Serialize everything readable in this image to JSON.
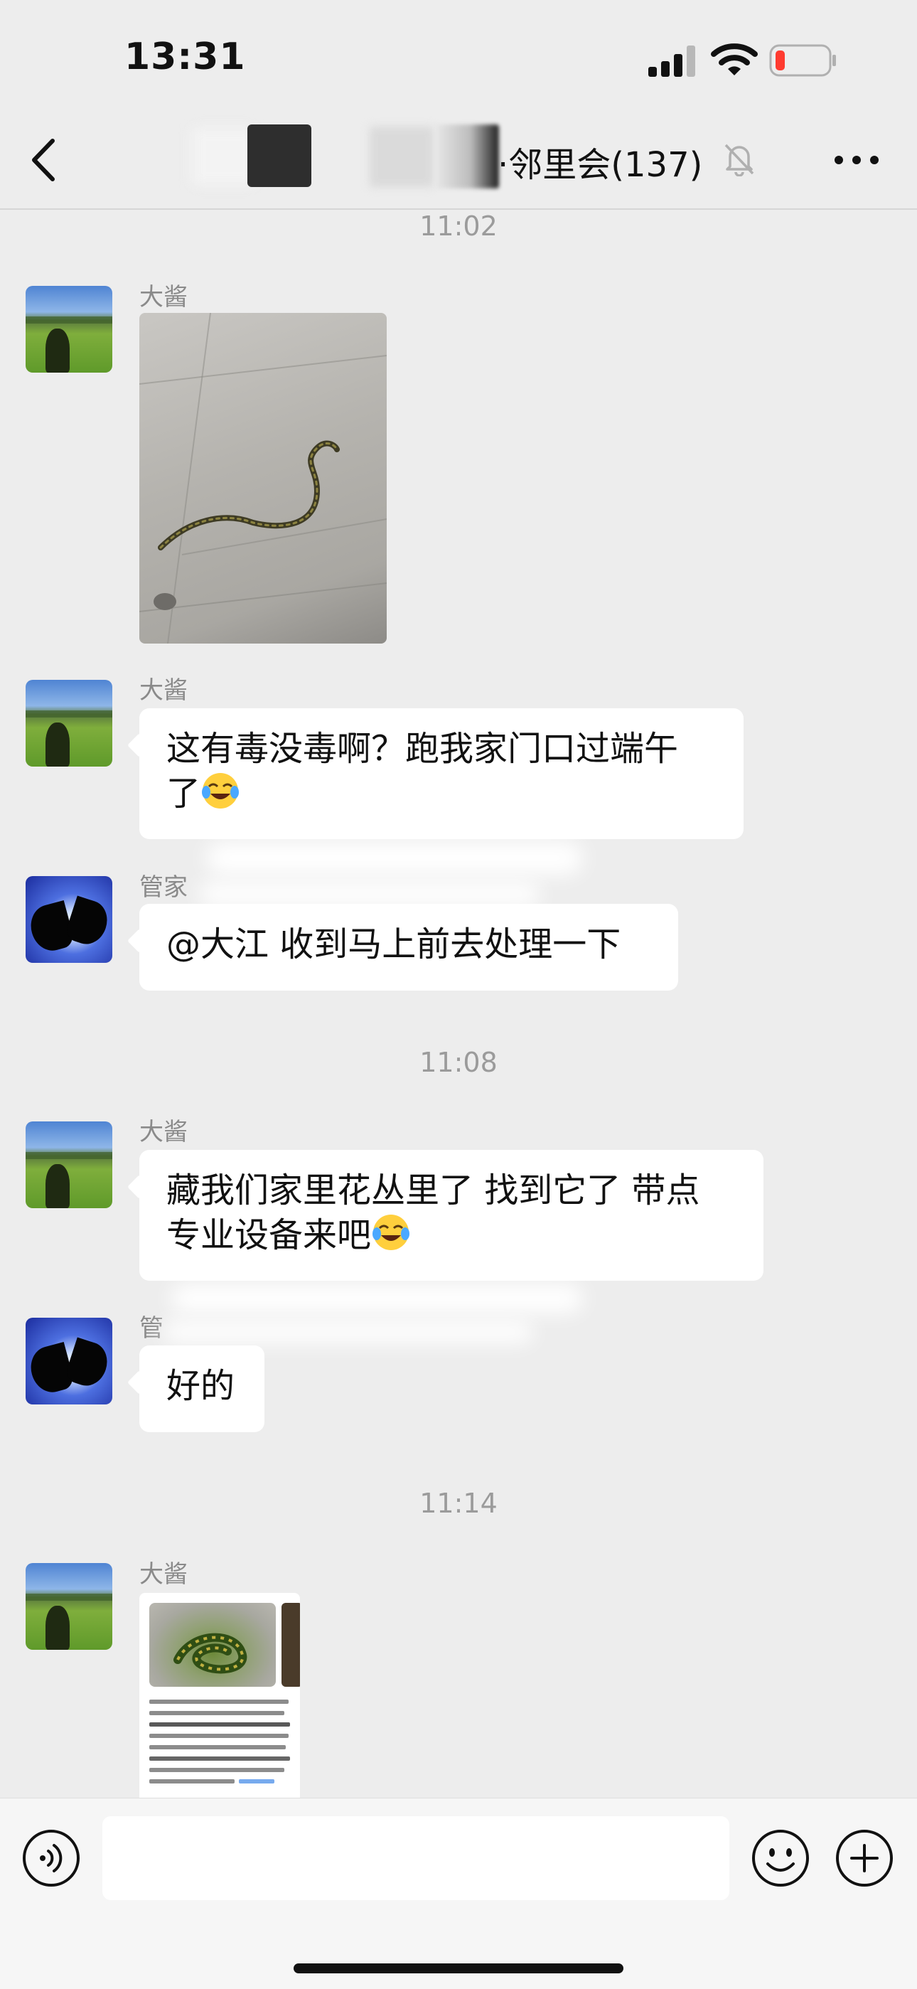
{
  "status_bar": {
    "time": "13:31",
    "icons": [
      "signal-icon",
      "wifi-icon",
      "battery-low-icon"
    ]
  },
  "nav": {
    "back_icon": "chevron-left-icon",
    "title": "·邻里会(137)",
    "mute_icon": "bell-slash-icon",
    "more_icon": "ellipsis-icon"
  },
  "messages": {
    "ts1": "11:02",
    "m1_sender": "大酱",
    "m2_sender": "大酱",
    "m2_line1": "这有毒没毒啊？跑我家门口过端午",
    "m2_line2": "了",
    "m3_sender": "管家",
    "m3_text": "@大江 收到马上前去处理一下",
    "ts2": "11:08",
    "m4_sender": "大酱",
    "m4_line1": "藏我们家里花丛里了 找到它了 带点",
    "m4_line2": "专业设备来吧",
    "m5_sender": "管",
    "m5_text": "好的",
    "ts3": "11:14",
    "m6_sender": "大酱"
  },
  "input_bar": {
    "voice_icon": "voice-icon",
    "emoji_icon": "smiley-icon",
    "plus_icon": "plus-circle-icon"
  },
  "colors": {
    "background": "#ededed",
    "bubble": "#ffffff",
    "timestamp": "#9b9b9b",
    "battery_low": "#ff3b30"
  }
}
